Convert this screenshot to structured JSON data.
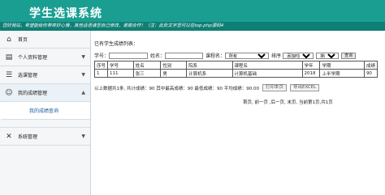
{
  "header": {
    "title": "学生选课系统",
    "notice": "您好我站，希望能给你带来好心情，其他话语请您自己修改，谢谢合作！（注：此处文字您可以在top.php源码4"
  },
  "sidebar": {
    "items": [
      {
        "label": "首页",
        "icon": "home-icon"
      },
      {
        "label": "个人资料管理",
        "icon": "clipboard-icon"
      },
      {
        "label": "选课管理",
        "icon": "list-icon"
      },
      {
        "label": "我的成绩管理",
        "icon": "users-icon"
      },
      {
        "label": "系统管理",
        "icon": "tools-icon"
      }
    ],
    "sub_item": "我的成绩查询"
  },
  "main": {
    "caption": "已有学生成绩列表：",
    "filter": {
      "xuehao_label": "学号：",
      "xuehao_value": "",
      "name_label": "姓名：",
      "name_value": "",
      "course_label": "课程名：",
      "course_selected": "所有",
      "sort_label": "排序",
      "sort_field_selected": "添加时间",
      "order_label": "排序",
      "order_selected": "",
      "search_button": "查询"
    },
    "table": {
      "headers": [
        "序号",
        "学号",
        "姓名",
        "性别",
        "院系",
        "课程名",
        "学年",
        "学期",
        "成绩"
      ],
      "rows": [
        [
          "1",
          "111",
          "张三",
          "男",
          "计算机系",
          "计算机基础",
          "2018",
          "上半学期",
          "90"
        ]
      ]
    },
    "stats": {
      "text": "以上数据共1条, 共计成绩：90  其中最高成绩：90  最低成绩：90  平均成绩：90.00",
      "print_button": "打印本页",
      "export_button": "导出EXCEL"
    },
    "pager": "首页, 前一页 ,后一页, 末页, 当前第1页,共1页"
  }
}
